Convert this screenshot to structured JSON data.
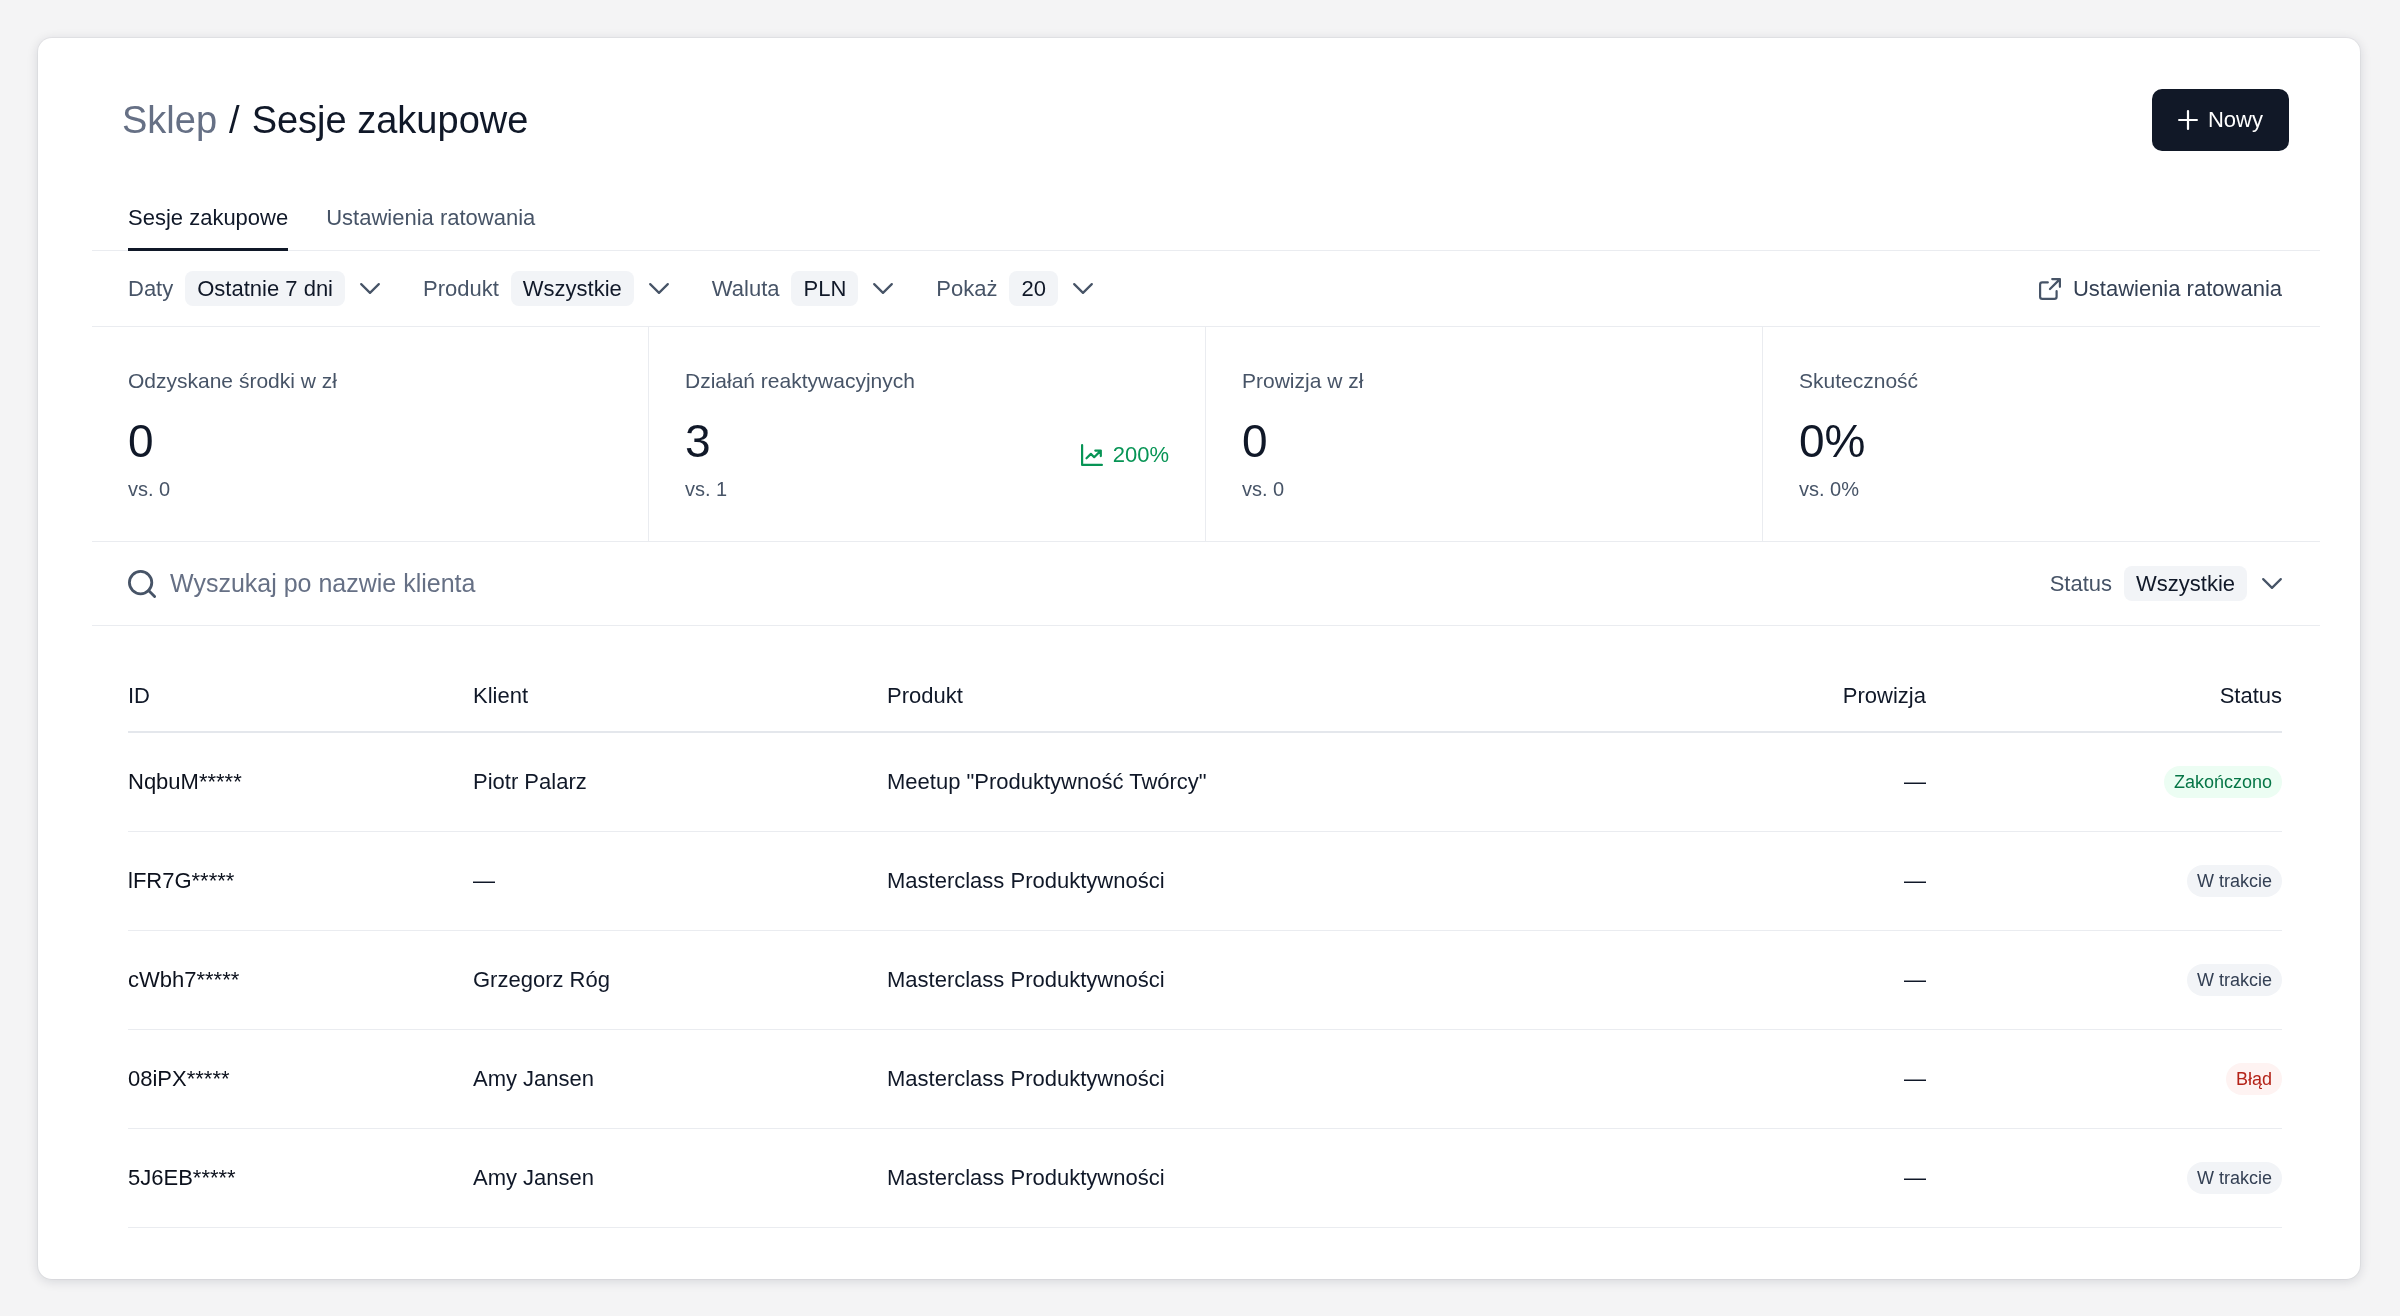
{
  "breadcrumb": {
    "parent": "Sklep",
    "separator": "/",
    "current": "Sesje zakupowe"
  },
  "new_button": {
    "label": "Nowy"
  },
  "tabs": [
    {
      "label": "Sesje zakupowe",
      "selected": true
    },
    {
      "label": "Ustawienia ratowania",
      "selected": false
    }
  ],
  "filters": [
    {
      "label": "Daty",
      "value": "Ostatnie 7 dni"
    },
    {
      "label": "Produkt",
      "value": "Wszystkie"
    },
    {
      "label": "Waluta",
      "value": "PLN"
    },
    {
      "label": "Pokaż",
      "value": "20"
    }
  ],
  "settings_link": {
    "label": "Ustawienia ratowania"
  },
  "stats": [
    {
      "label": "Odzyskane środki w zł",
      "value": "0",
      "comparison": "vs. 0"
    },
    {
      "label": "Działań reaktywacyjnych",
      "value": "3",
      "comparison": "vs. 1",
      "change": {
        "value": "200%",
        "kind": "increase"
      }
    },
    {
      "label": "Prowizja w zł",
      "value": "0",
      "comparison": "vs. 0"
    },
    {
      "label": "Skuteczność",
      "value": "0%",
      "comparison": "vs. 0%"
    }
  ],
  "search": {
    "placeholder": "Wyszukaj po nazwie klienta"
  },
  "status_filter": {
    "label": "Status",
    "value": "Wszystkie"
  },
  "table": {
    "columns": [
      "ID",
      "Klient",
      "Produkt",
      "Prowizja",
      "Status"
    ],
    "rows": [
      {
        "id": "NqbuM*****",
        "client": "Piotr Palarz",
        "product": "Meetup \"Produktywność Twórcy\"",
        "commission": "—",
        "status": {
          "label": "Zakończono",
          "kind": "success"
        }
      },
      {
        "id": "lFR7G*****",
        "client": "—",
        "product": "Masterclass Produktywności",
        "commission": "—",
        "status": {
          "label": "W trakcie",
          "kind": "pending"
        }
      },
      {
        "id": "cWbh7*****",
        "client": "Grzegorz Róg",
        "product": "Masterclass Produktywności",
        "commission": "—",
        "status": {
          "label": "W trakcie",
          "kind": "pending"
        }
      },
      {
        "id": "08iPX*****",
        "client": "Amy Jansen",
        "product": "Masterclass Produktywności",
        "commission": "—",
        "status": {
          "label": "Błąd",
          "kind": "error"
        }
      },
      {
        "id": "5J6EB*****",
        "client": "Amy Jansen",
        "product": "Masterclass Produktywności",
        "commission": "—",
        "status": {
          "label": "W trakcie",
          "kind": "pending"
        }
      }
    ]
  }
}
